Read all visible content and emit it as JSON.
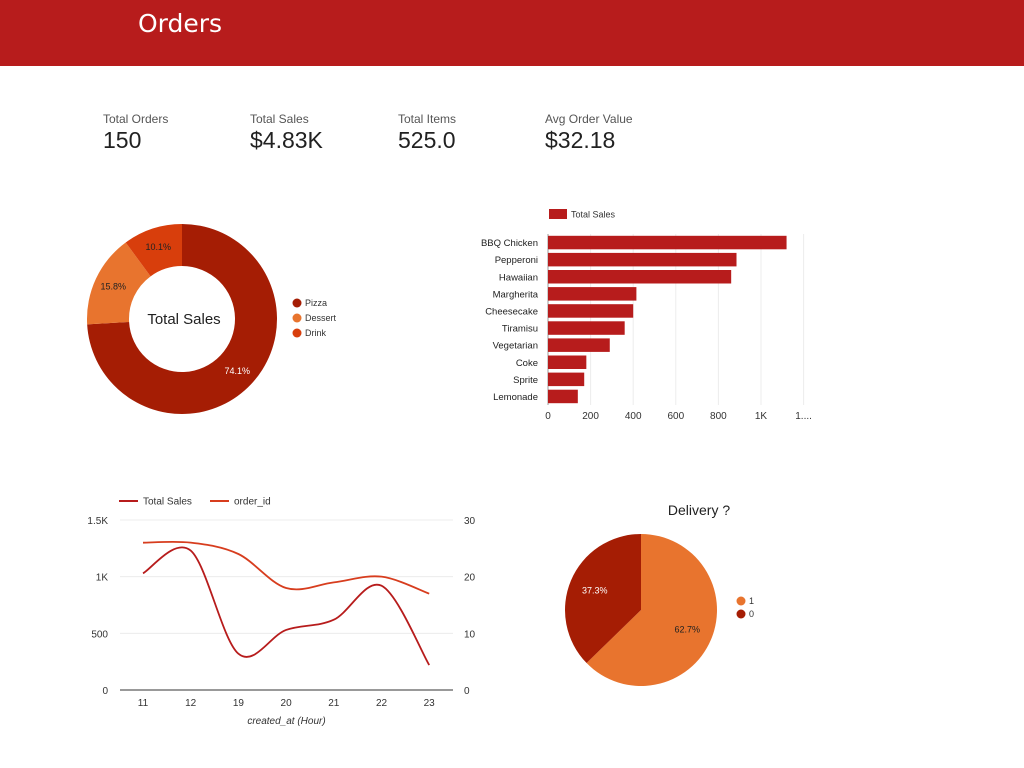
{
  "header": {
    "title": "Orders"
  },
  "kpis": [
    {
      "label": "Total Orders",
      "value": "150"
    },
    {
      "label": "Total Sales",
      "value": "$4.83K"
    },
    {
      "label": "Total Items",
      "value": "525.0"
    },
    {
      "label": "Avg Order Value",
      "value": "$32.18"
    }
  ],
  "colors": {
    "header": "#b71c1c",
    "dark_red": "#a51d04",
    "orange": "#e8742e",
    "red_orange": "#d83e0c",
    "bar": "#b71c1c",
    "line1": "#b71c1c",
    "line2": "#d73d1e",
    "grid": "#ececec"
  },
  "chart_data": [
    {
      "type": "pie",
      "variant": "donut",
      "center_label": "Total Sales",
      "slices": [
        {
          "name": "Pizza",
          "value": 74.1,
          "label": "74.1%",
          "color": "#a51d04"
        },
        {
          "name": "Dessert",
          "value": 15.8,
          "label": "15.8%",
          "color": "#e8742e"
        },
        {
          "name": "Drink",
          "value": 10.1,
          "label": "10.1%",
          "color": "#d83e0c"
        }
      ],
      "legend": "right"
    },
    {
      "type": "bar",
      "orientation": "horizontal",
      "legend": "top",
      "series_name": "Total Sales",
      "categories": [
        "BBQ Chicken",
        "Pepperoni",
        "Hawaiian",
        "Margherita",
        "Cheesecake",
        "Tiramisu",
        "Vegetarian",
        "Coke",
        "Sprite",
        "Lemonade"
      ],
      "values": [
        1120,
        885,
        860,
        415,
        400,
        360,
        290,
        180,
        170,
        140
      ],
      "xticks": [
        "0",
        "200",
        "400",
        "600",
        "800",
        "1K",
        "1...."
      ],
      "xlim": [
        0,
        1200
      ],
      "grid": true
    },
    {
      "type": "line",
      "categories": [
        "11",
        "12",
        "19",
        "20",
        "21",
        "22",
        "23"
      ],
      "xlabel": "created_at (Hour)",
      "series": [
        {
          "name": "Total Sales",
          "axis": "left",
          "values": [
            1030,
            1230,
            320,
            530,
            620,
            920,
            220
          ]
        },
        {
          "name": "order_id",
          "axis": "right",
          "values": [
            26,
            26,
            24,
            18,
            19,
            20,
            17
          ]
        }
      ],
      "yticks_left": [
        "0",
        "500",
        "1K",
        "1.5K"
      ],
      "yticks_right": [
        "0",
        "10",
        "20",
        "30"
      ],
      "ylim_left": [
        0,
        1500
      ],
      "ylim_right": [
        0,
        30
      ],
      "legend": "top-left",
      "grid": true
    },
    {
      "type": "pie",
      "title": "Delivery ?",
      "slices": [
        {
          "name": "1",
          "value": 62.7,
          "label": "62.7%",
          "color": "#e8742e"
        },
        {
          "name": "0",
          "value": 37.3,
          "label": "37.3%",
          "color": "#a51d04"
        }
      ],
      "legend": "right"
    }
  ]
}
